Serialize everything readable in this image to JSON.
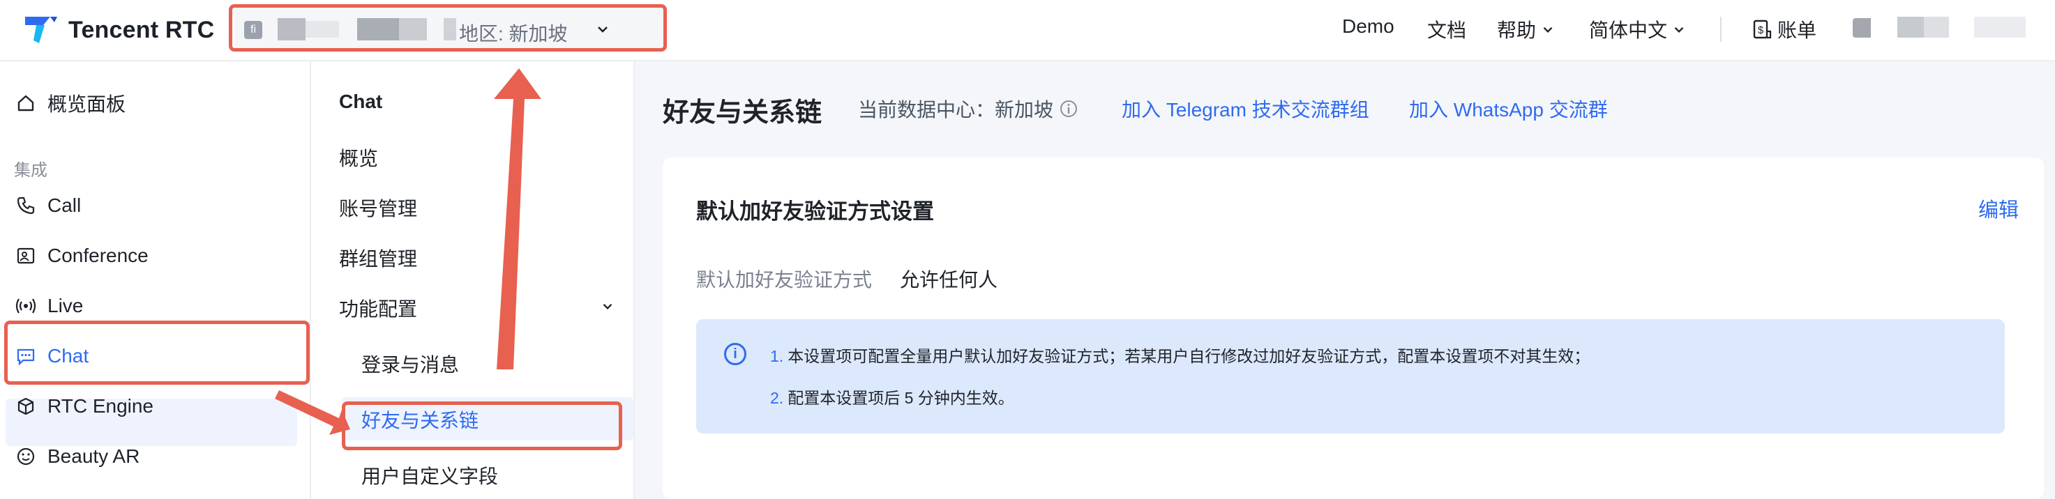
{
  "brand": {
    "name": "Tencent RTC"
  },
  "app_selector": {
    "avatar_letter": "fi",
    "region_text": "地区: 新加坡"
  },
  "top_nav": {
    "demo": "Demo",
    "docs": "文档",
    "help": "帮助",
    "language": "简体中文",
    "billing": "账单"
  },
  "sidebar": {
    "overview": "概览面板",
    "group_integration": "集成",
    "items": [
      "Call",
      "Conference",
      "Live",
      "Chat",
      "RTC Engine",
      "Beauty AR"
    ]
  },
  "subbar": {
    "title": "Chat",
    "items": [
      "概览",
      "账号管理",
      "群组管理",
      "功能配置"
    ],
    "subitems": [
      "登录与消息",
      "好友与关系链",
      "用户自定义字段"
    ]
  },
  "main": {
    "title": "好友与关系链",
    "datacenter_label": "当前数据中心：新加坡",
    "telegram_link": "加入 Telegram 技术交流群组",
    "whatsapp_link": "加入 WhatsApp 交流群",
    "card": {
      "title": "默认加好友验证方式设置",
      "edit": "编辑",
      "field_label": "默认加好友验证方式",
      "field_value": "允许任何人",
      "info_lines": [
        {
          "num": "1.",
          "text": "本设置项可配置全量用户默认加好友验证方式；若某用户自行修改过加好友验证方式，配置本设置项不对其生效；"
        },
        {
          "num": "2.",
          "text": "配置本设置项后 5 分钟内生效。"
        }
      ]
    }
  },
  "colors": {
    "accent": "#2f6bf0",
    "annotation": "#e8604f",
    "info_bg": "#dce8fc"
  }
}
